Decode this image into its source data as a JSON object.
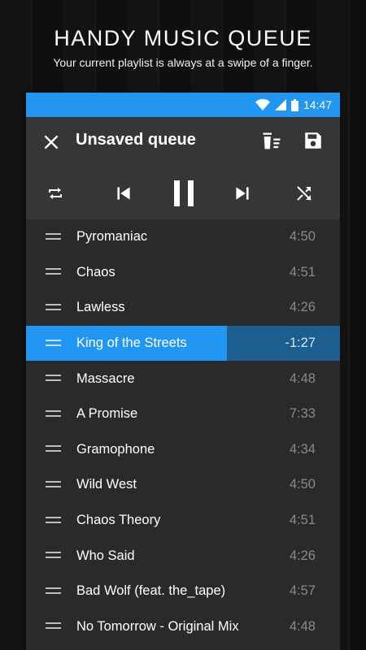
{
  "promo": {
    "title": "HANDY MUSIC QUEUE",
    "subtitle": "Your current playlist is always at a swipe of a finger."
  },
  "status_bar": {
    "time": "14:47",
    "icons": [
      "wifi-icon",
      "signal-icon",
      "battery-icon"
    ],
    "color": "#2196f3"
  },
  "toolbar": {
    "title": "Unsaved queue",
    "close_icon": "close-icon",
    "clear_icon": "clear-queue-icon",
    "save_icon": "save-icon"
  },
  "controls": [
    "repeat-icon",
    "skip-previous-icon",
    "pause-icon",
    "skip-next-icon",
    "shuffle-icon"
  ],
  "playback": {
    "current_index": 3,
    "progress_fraction": 0.64
  },
  "queue": [
    {
      "title": "Pyromaniac",
      "duration": "4:50"
    },
    {
      "title": "Chaos",
      "duration": "4:51"
    },
    {
      "title": "Lawless",
      "duration": "4:26"
    },
    {
      "title": "King of the Streets",
      "duration": "-1:27"
    },
    {
      "title": "Massacre",
      "duration": "4:48"
    },
    {
      "title": "A Promise",
      "duration": "7:33"
    },
    {
      "title": "Gramophone",
      "duration": "4:34"
    },
    {
      "title": "Wild West",
      "duration": "4:50"
    },
    {
      "title": "Chaos Theory",
      "duration": "4:51"
    },
    {
      "title": "Who Said",
      "duration": "4:26"
    },
    {
      "title": "Bad Wolf (feat. the_tape)",
      "duration": "4:57"
    },
    {
      "title": "No Tomorrow - Original Mix",
      "duration": "4:48"
    }
  ]
}
